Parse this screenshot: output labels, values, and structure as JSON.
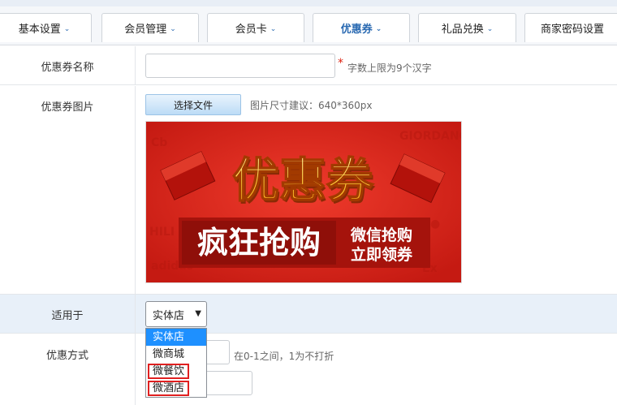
{
  "tabs": [
    {
      "label": "基本设置",
      "has_chevron": true,
      "active": false
    },
    {
      "label": "会员管理",
      "has_chevron": true,
      "active": false
    },
    {
      "label": "会员卡",
      "has_chevron": true,
      "active": false
    },
    {
      "label": "优惠券",
      "has_chevron": true,
      "active": true
    },
    {
      "label": "礼品兑换",
      "has_chevron": true,
      "active": false
    },
    {
      "label": "商家密码设置",
      "has_chevron": false,
      "active": false
    }
  ],
  "chevron_glyph": "⌄",
  "form": {
    "name": {
      "label": "优惠券名称",
      "value": "",
      "required_mark": "*",
      "hint": "字数上限为9个汉字"
    },
    "image": {
      "label": "优惠券图片",
      "button_label": "选择文件",
      "hint": "图片尺寸建议：640*360px",
      "banner": {
        "main_text": "优惠券",
        "sub_text": "疯狂抢购",
        "side_line1": "微信抢购",
        "side_line2": "立即领券",
        "red_bg": "#d8251c",
        "gold": "#ffcf3a"
      }
    },
    "applies_to": {
      "label": "适用于",
      "selected": "实体店",
      "arrow_glyph": "▼",
      "options": [
        "实体店",
        "微商城",
        "微餐饮",
        "微酒店"
      ]
    },
    "discount": {
      "label": "优惠方式",
      "hint": "在0-1之间，1为不打折"
    }
  }
}
